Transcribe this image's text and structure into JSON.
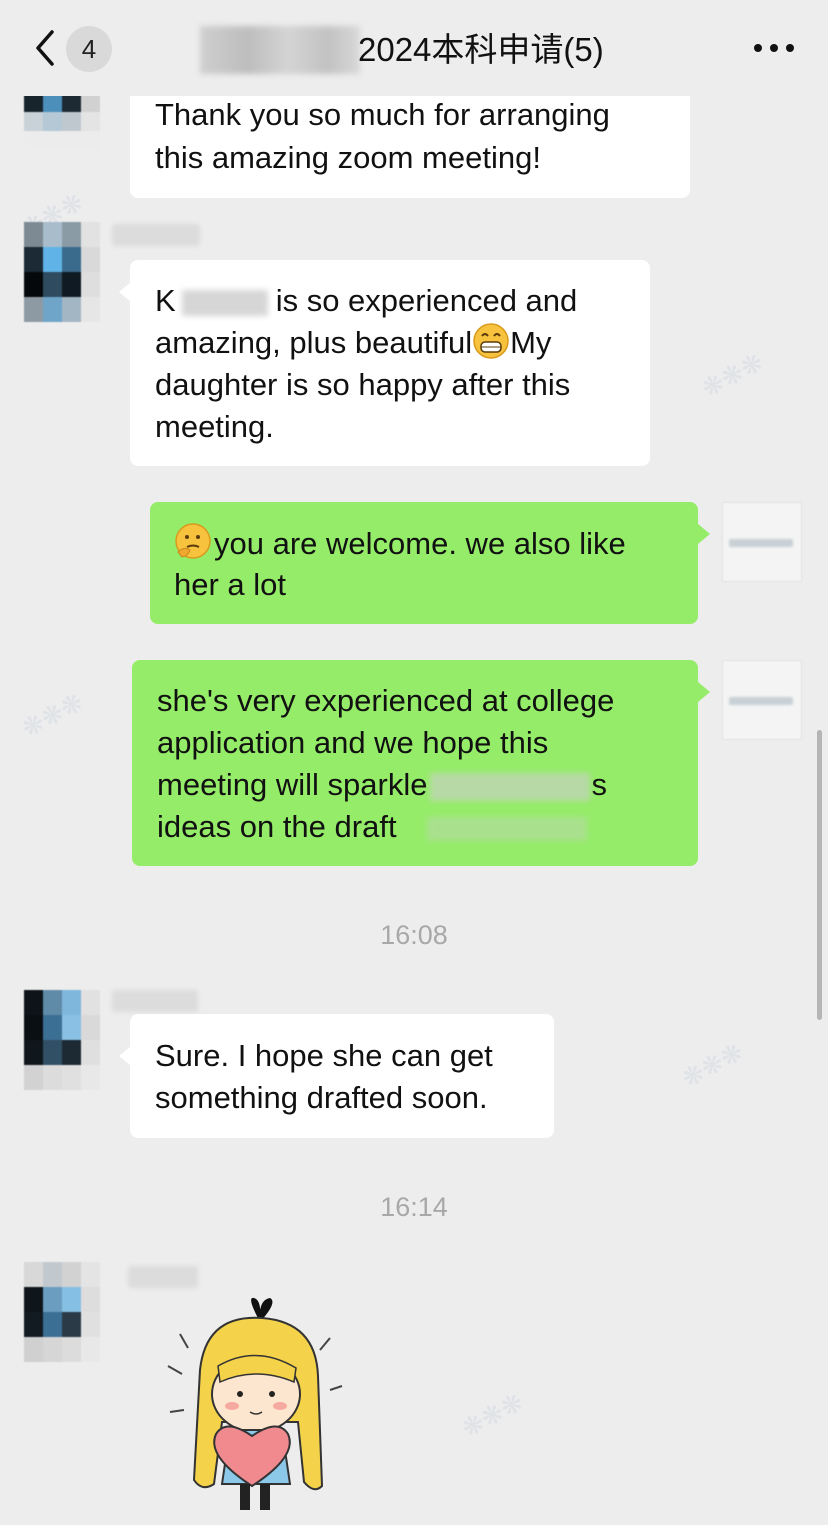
{
  "header": {
    "unread_count": "4",
    "title": "2024本科申请(5)",
    "back_icon": "chevron-left-icon",
    "more_icon": "more-dots-icon"
  },
  "messages": [
    {
      "side": "left",
      "lines": [
        "Thank you so much for arranging",
        "this amazing zoom meeting!"
      ]
    },
    {
      "side": "left",
      "line1_start": "K",
      "line1_end": "is so experienced and",
      "line2_start": "amazing, plus beautiful",
      "line2_emoji": "grinning-emoji",
      "line2_end": "My",
      "line3": "daughter is so happy after this",
      "line4": "meeting."
    },
    {
      "side": "right",
      "emoji": "thinking-emoji",
      "line1": "you are welcome. we also like",
      "line2": "her a lot"
    },
    {
      "side": "right",
      "line1": "she's very experienced at college",
      "line2": "application and we hope this",
      "line3_start": "meeting will sparkle",
      "line3_end": "s",
      "line4": "ideas on the draft"
    },
    {
      "side": "left",
      "lines": [
        "Sure. I hope she can get",
        "something drafted soon."
      ]
    }
  ],
  "timestamps": [
    "16:08",
    "16:14"
  ],
  "sticker": {
    "name": "girl-holding-heart-sticker"
  },
  "colors": {
    "background": "#ededed",
    "bubble_white": "#ffffff",
    "bubble_green": "#95ec69",
    "timestamp": "#a8a8a8"
  }
}
